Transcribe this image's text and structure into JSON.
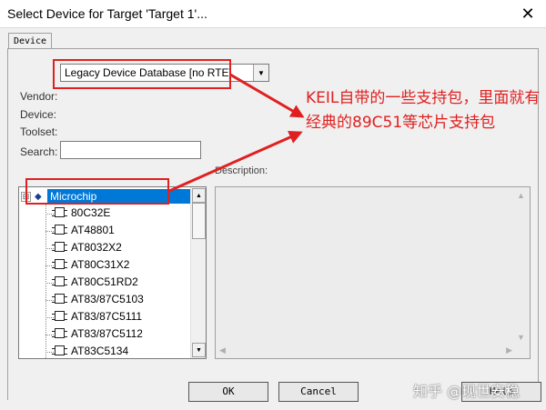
{
  "window": {
    "title": "Select Device for Target 'Target 1'...",
    "close_glyph": "✕"
  },
  "tabs": [
    {
      "label": "Device"
    }
  ],
  "device_database": {
    "selected": "Legacy Device Database [no RTE]",
    "arrow_glyph": "▼"
  },
  "info_labels": {
    "vendor": "Vendor:",
    "device": "Device:",
    "toolset": "Toolset:"
  },
  "search": {
    "label": "Search:",
    "value": ""
  },
  "description": {
    "label": "Description:",
    "text": ""
  },
  "tree": {
    "expander_glyph": "⊟",
    "vendor_icon_glyph": "◆",
    "vendor": "Microchip",
    "items": [
      "80C32E",
      "AT48801",
      "AT8032X2",
      "AT80C31X2",
      "AT80C51RD2",
      "AT83/87C5103",
      "AT83/87C5111",
      "AT83/87C5112",
      "AT83C5134"
    ]
  },
  "buttons": {
    "ok": "OK",
    "cancel": "Cancel",
    "help": "Help"
  },
  "annotation": {
    "text": "KEIL自带的一些支持包，里面就有经典的89C51等芯片支持包",
    "color": "#e02020"
  },
  "watermark": {
    "text": "知乎 @现世安稳"
  }
}
